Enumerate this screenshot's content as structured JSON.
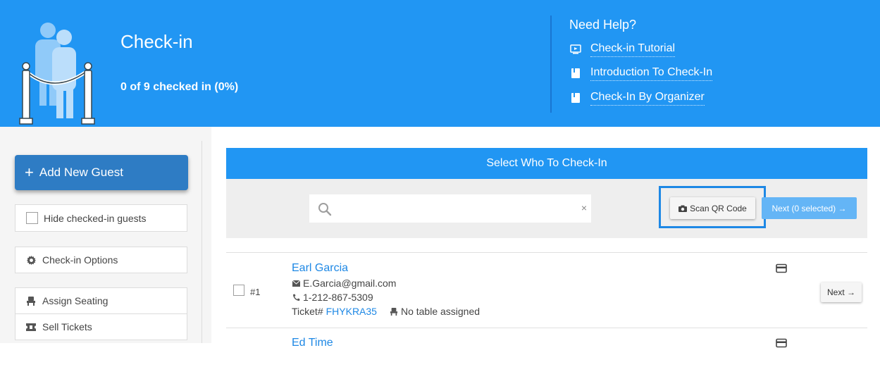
{
  "header": {
    "title": "Check-in",
    "count": "0 of 9 checked in (0%)",
    "help": {
      "title": "Need Help?",
      "links": [
        {
          "label": "Check-in Tutorial",
          "icon": "video-icon"
        },
        {
          "label": "Introduction To Check-In",
          "icon": "book-icon"
        },
        {
          "label": "Check-In By Organizer",
          "icon": "book-icon"
        }
      ]
    }
  },
  "sidebar": {
    "add_guest": "Add New Guest",
    "add_icon": "+",
    "hide_checked": "Hide checked-in guests",
    "options": "Check-in Options",
    "assign_seating": "Assign Seating",
    "sell_tickets": "Sell Tickets"
  },
  "panel": {
    "title": "Select Who To Check-In",
    "search_placeholder": "",
    "clear": "×",
    "scan_qr": "Scan QR Code",
    "next_selected": "Next (0 selected) →"
  },
  "guests": [
    {
      "num": "#1",
      "name": "Earl Garcia",
      "email": "E.Garcia@gmail.com",
      "phone": "1-212-867-5309",
      "ticket_label": "Ticket#",
      "ticket": "FHYKRA35",
      "table": "No table assigned",
      "next": "Next →"
    },
    {
      "name": "Ed Time"
    }
  ],
  "colors": {
    "brand_blue": "#2196f3",
    "button_blue": "#2e7cc4",
    "link_blue": "#1e88e5",
    "next_disabled": "#64b5f6"
  }
}
